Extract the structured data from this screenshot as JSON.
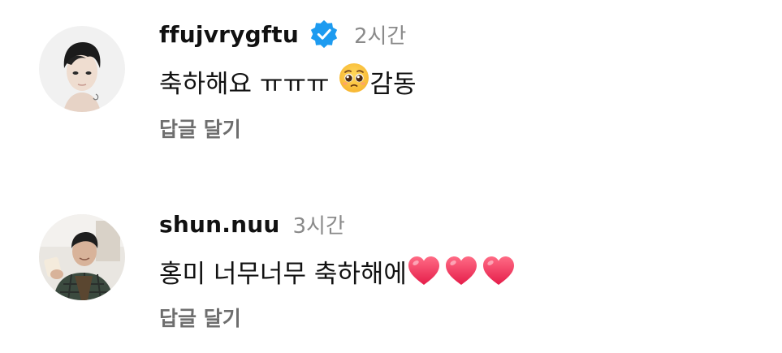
{
  "comments": [
    {
      "username": "ffujvrygftu",
      "verified": true,
      "time": "2시간",
      "text": "축하해요 ㅠㅠㅠ",
      "trailing_emoji": "pleading-face",
      "trailing_text": "감동",
      "reply_label": "답글 달기"
    },
    {
      "username": "shun.nuu",
      "verified": false,
      "time": "3시간",
      "text": "홍미 너무너무 축하해에",
      "trailing_emoji": "red-heart x3",
      "reply_label": "답글 달기"
    }
  ],
  "colors": {
    "verified_blue": "#1d9bf0",
    "time_gray": "#8a8a8a",
    "reply_gray": "#6e6e6e",
    "heart_red": "#f0345a"
  }
}
